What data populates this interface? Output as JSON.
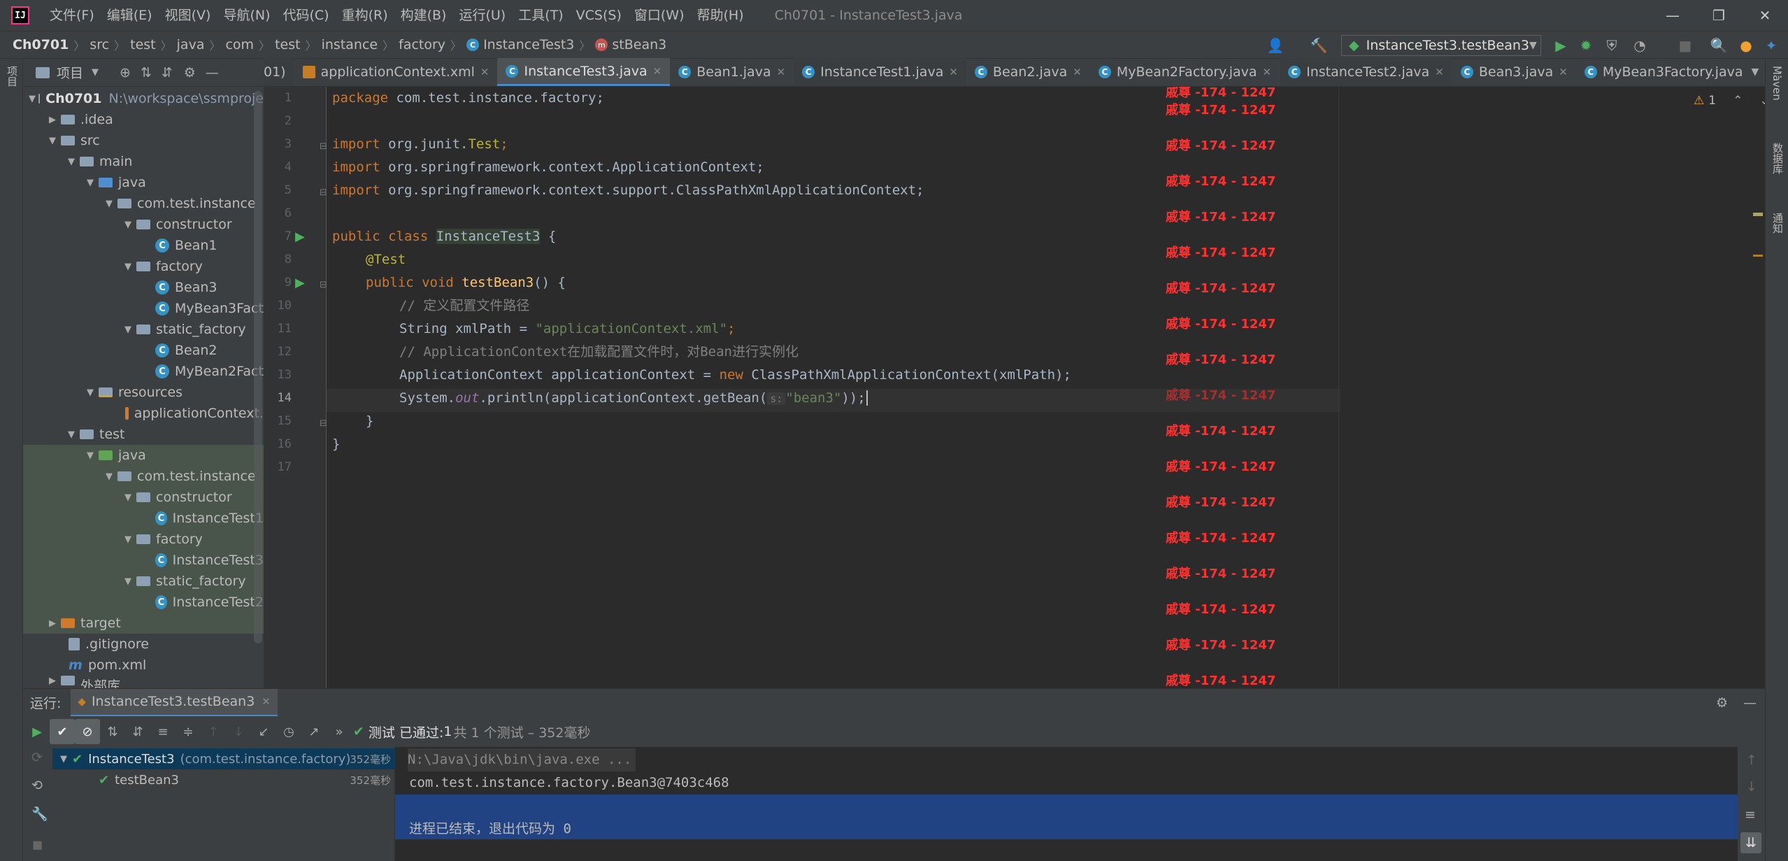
{
  "titlebar": {
    "logo_text": "IJ",
    "menu": [
      "文件(F)",
      "编辑(E)",
      "视图(V)",
      "导航(N)",
      "代码(C)",
      "重构(R)",
      "构建(B)",
      "运行(U)",
      "工具(T)",
      "VCS(S)",
      "窗口(W)",
      "帮助(H)"
    ],
    "window_title": "Ch0701 - InstanceTest3.java"
  },
  "navbar": {
    "breadcrumbs": [
      "Ch0701",
      "src",
      "test",
      "java",
      "com",
      "test",
      "instance",
      "factory",
      "InstanceTest3",
      "stBean3"
    ],
    "run_config": "InstanceTest3.testBean3"
  },
  "left_stripe": {
    "project_label": "项目"
  },
  "right_stripe": {
    "maven_label": "Maven",
    "db_label": "数据库",
    "notify_label": "通知"
  },
  "project_panel": {
    "title": "项目"
  },
  "tree": {
    "root_name": "Ch0701",
    "root_path": "N:\\workspace\\ssmproje",
    "items": [
      ".idea",
      "src",
      "main",
      "java",
      "com.test.instance",
      "constructor",
      "Bean1",
      "factory",
      "Bean3",
      "MyBean3Fact",
      "static_factory",
      "Bean2",
      "MyBean2Fact",
      "resources",
      "applicationContext.",
      "test",
      "java",
      "com.test.instance",
      "constructor",
      "InstanceTest1",
      "factory",
      "InstanceTest3",
      "static_factory",
      "InstanceTest2",
      "target",
      ".gitignore",
      "pom.xml",
      "外部库"
    ]
  },
  "tabs": {
    "partial": "01)",
    "items": [
      "applicationContext.xml",
      "InstanceTest3.java",
      "Bean1.java",
      "InstanceTest1.java",
      "Bean2.java",
      "MyBean2Factory.java",
      "InstanceTest2.java",
      "Bean3.java",
      "MyBean3Factory.java"
    ]
  },
  "editor": {
    "line_numbers": [
      "1",
      "2",
      "3",
      "4",
      "5",
      "6",
      "7",
      "8",
      "9",
      "10",
      "11",
      "12",
      "13",
      "14",
      "15",
      "16",
      "17"
    ],
    "warning_count": "1",
    "code": {
      "l1_kw": "package",
      "l1_rest": " com.test.instance.factory;",
      "l3_kw": "import",
      "l3_rest": " org.junit.",
      "l3_cls": "Test",
      "l3_end": ";",
      "l4_kw": "import",
      "l4_rest": " org.springframework.context.ApplicationContext;",
      "l5_kw": "import",
      "l5_rest": " org.springframework.context.support.ClassPathXmlApplicationContext;",
      "l7_kw": "public class ",
      "l7_cls": "InstanceTest3",
      "l7_end": " {",
      "l8_ann": "@Test",
      "l9_kw": "public void ",
      "l9_fn": "testBean3",
      "l9_end": "() {",
      "l10_cm": "// 定义配置文件路径",
      "l11_a": "String xmlPath = ",
      "l11_str": "\"applicationContext.xml\"",
      "l11_end": ";",
      "l12_cm": "// ApplicationContext在加载配置文件时，对Bean进行实例化",
      "l13_a": "ApplicationContext applicationContext = ",
      "l13_kw": "new",
      "l13_end": " ClassPathXmlApplicationContext(xmlPath);",
      "l14_a": "System.",
      "l14_out": "out",
      "l14_b": ".println(applicationContext.getBean(",
      "l14_hint": "s:",
      "l14_str": "\"bean3\"",
      "l14_end": "));",
      "l15": "}",
      "l16": "}"
    }
  },
  "watermark": "戚尊 -174 - 1247",
  "run_panel": {
    "label": "运行:",
    "tab": "InstanceTest3.testBean3",
    "status_prefix": "测试 已通过: ",
    "status_count": "1",
    "status_suffix": "共 1 个测试 – 352毫秒",
    "tests": [
      {
        "name": "InstanceTest3",
        "pkg": "(com.test.instance.factory)",
        "duration": "352毫秒"
      },
      {
        "name": "testBean3",
        "duration": "352毫秒"
      }
    ],
    "console": [
      "N:\\Java\\jdk\\bin\\java.exe ...",
      "com.test.instance.factory.Bean3@7403c468",
      "",
      "进程已结束，退出代码为 0"
    ]
  }
}
